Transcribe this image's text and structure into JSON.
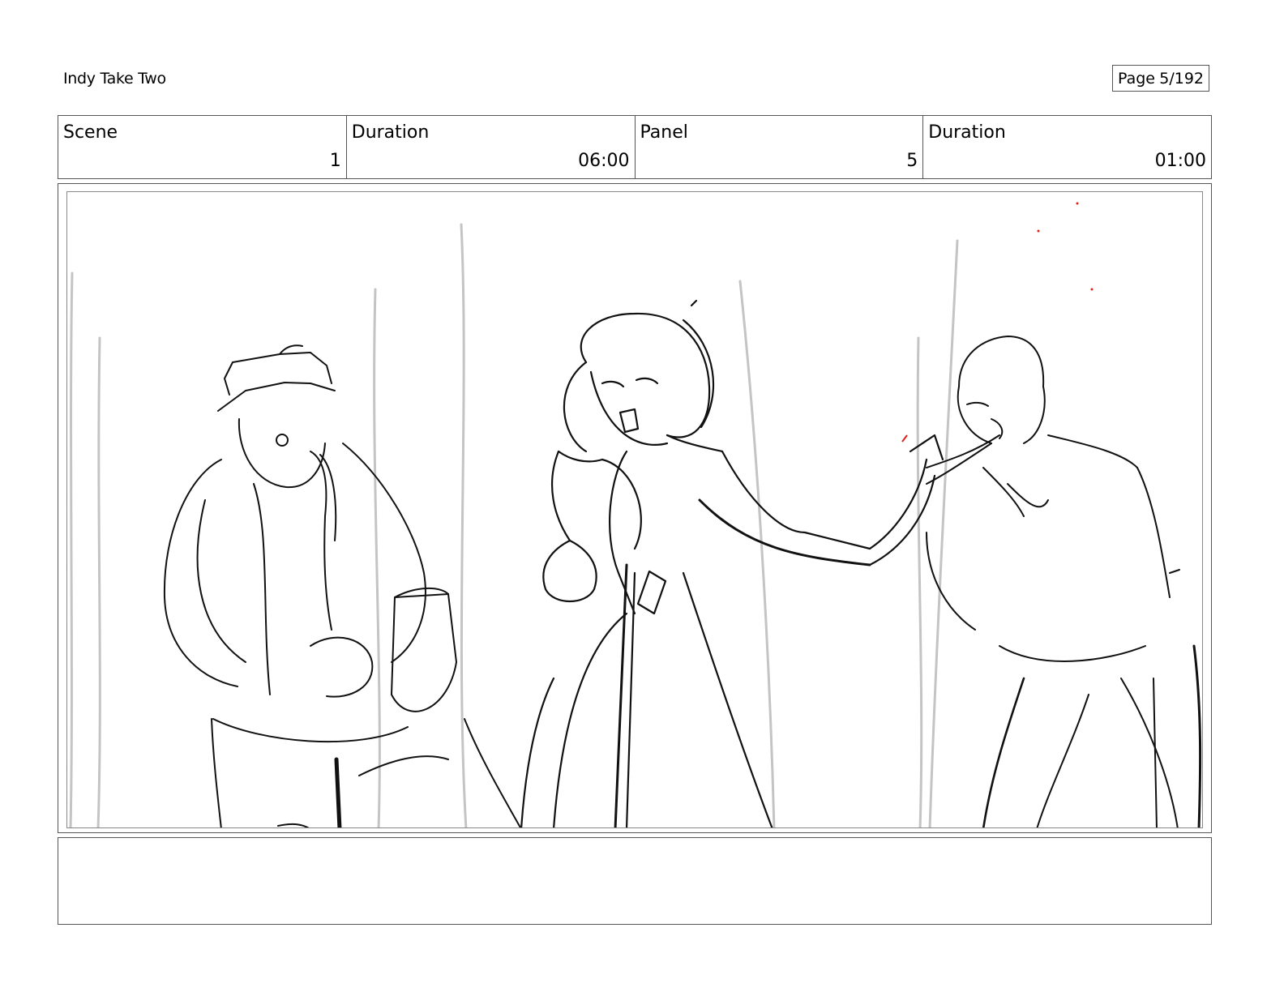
{
  "document": {
    "title": "Indy Take Two"
  },
  "page": {
    "label": "Page",
    "number": "5/192"
  },
  "meta": {
    "scene_label": "Scene",
    "scene_value": "1",
    "scene_duration_label": "Duration",
    "scene_duration_value": "06:00",
    "panel_label": "Panel",
    "panel_value": "5",
    "panel_duration_label": "Duration",
    "panel_duration_value": "01:00"
  },
  "notes": {
    "text": ""
  },
  "colors": {
    "sketch": "#111111",
    "curtain": "#c4c4c4",
    "accent": "#d9261c"
  }
}
